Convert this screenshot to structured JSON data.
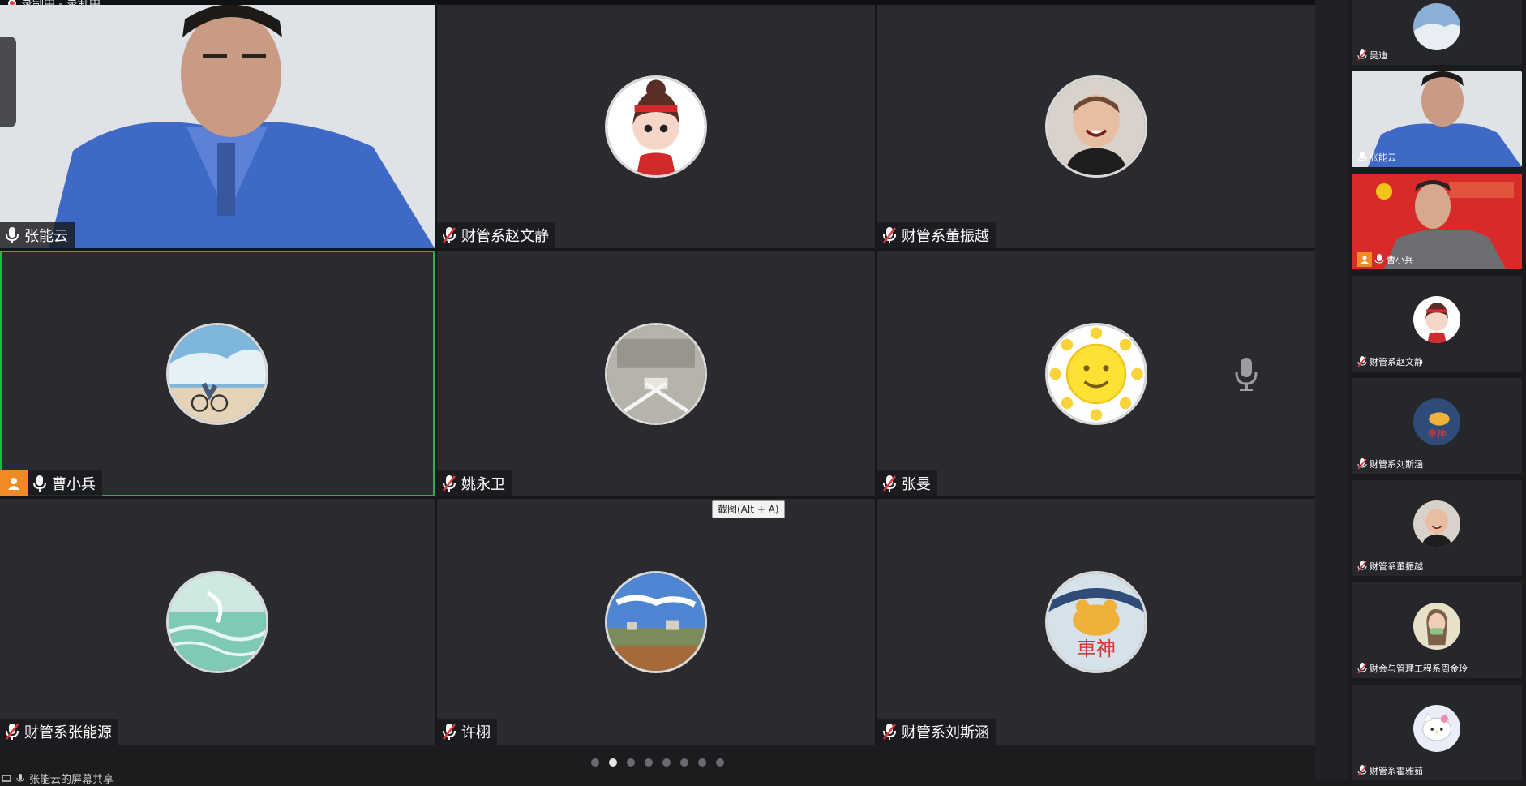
{
  "recording": {
    "text": "录制中 - 录制中"
  },
  "tiles": [
    {
      "name": "张能云",
      "video": true,
      "host": false,
      "mic": "on"
    },
    {
      "name": "财管系赵文静",
      "video": false,
      "mic": "muted",
      "avatar": "girl-cartoon"
    },
    {
      "name": "财管系董振越",
      "video": false,
      "mic": "muted",
      "avatar": "boy-photo"
    },
    {
      "name": "曹小兵",
      "video": false,
      "host": true,
      "mic": "on",
      "avatar": "cyclist-sky",
      "active": true
    },
    {
      "name": "姚永卫",
      "video": false,
      "mic": "muted",
      "avatar": "building-photo"
    },
    {
      "name": "张旻",
      "video": false,
      "mic": "muted",
      "avatar": "sun-cartoon"
    },
    {
      "name": "财管系张能源",
      "video": false,
      "mic": "muted",
      "avatar": "water-wave"
    },
    {
      "name": "许栩",
      "video": false,
      "mic": "muted",
      "avatar": "landscape"
    },
    {
      "name": "财管系刘斯涵",
      "video": false,
      "mic": "muted",
      "avatar": "bear-car"
    }
  ],
  "tooltip": {
    "text": "截图(Alt + A)"
  },
  "pager": {
    "pages": 8,
    "current": 2
  },
  "bottom_status": {
    "text": "张能云的屏幕共享"
  },
  "sidebar": [
    {
      "name": "吴迪",
      "mic": "muted",
      "avatar": "sky"
    },
    {
      "name": "张能云",
      "mic": "on",
      "video": true
    },
    {
      "name": "曹小兵",
      "mic": "on",
      "video": true,
      "host": true,
      "active": true
    },
    {
      "name": "财管系赵文静",
      "mic": "muted",
      "avatar": "girl-cartoon"
    },
    {
      "name": "财管系刘斯涵",
      "mic": "muted",
      "avatar": "bear-car"
    },
    {
      "name": "财管系董振越",
      "mic": "muted",
      "avatar": "boy-photo"
    },
    {
      "name": "财会与管理工程系周金玲",
      "mic": "muted",
      "avatar": "girl-photo"
    },
    {
      "name": "财管系霍雅茹",
      "mic": "muted",
      "avatar": "kitty"
    }
  ],
  "colors": {
    "host_badge": "#f08a24",
    "active_border": "#27b34a",
    "muted_mic": "#e0383b",
    "tile_bg": "#2a2b2f"
  }
}
